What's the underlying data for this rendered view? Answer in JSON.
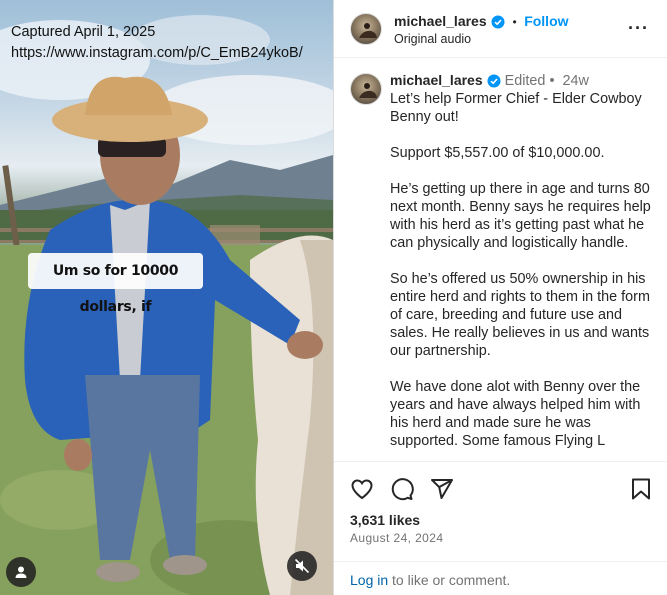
{
  "media": {
    "capture_date": "Captured April 1, 2025",
    "capture_url": "https://www.instagram.com/p/C_EmB24ykoB/",
    "caption_overlay": "Um so for 10000 dollars, if"
  },
  "header": {
    "username": "michael_lares",
    "follow_label": "Follow",
    "audio": "Original audio",
    "dot": "•",
    "more": "···"
  },
  "comment": {
    "username": "michael_lares",
    "edited": "Edited",
    "dot": "•",
    "age": "24w",
    "paragraphs": [
      "Let’s help Former Chief - Elder Cowboy Benny out!",
      "Support $5,557.00 of $10,000.00.",
      "He’s getting up there in age and turns 80 next month. Benny says he requires help with his herd as it’s getting past what he can physically and logistically handle.",
      "So he’s offered us 50% ownership in his entire herd and rights to them in the form of care, breeding and future use and sales. He really believes in us and wants our partnership.",
      "We have done alot with Benny over the years and have always helped him with his herd and made sure he was supported. Some famous Flying L"
    ]
  },
  "actions": {
    "likes": "3,631 likes",
    "date": "August 24, 2024",
    "login_link": "Log in",
    "login_rest": " to like or comment."
  },
  "colors": {
    "accent": "#0095f6",
    "verified": "#0095f6",
    "text": "#262626",
    "muted": "#737373"
  }
}
